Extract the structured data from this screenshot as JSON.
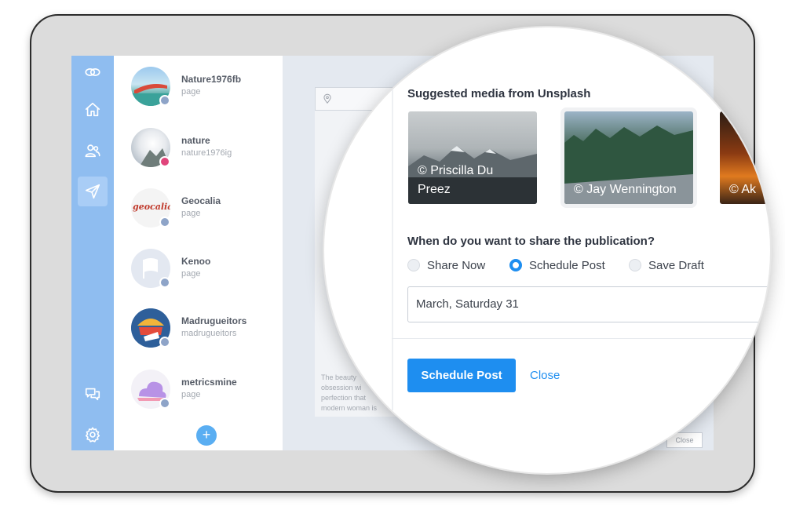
{
  "accounts": [
    {
      "name": "Nature1976fb",
      "type": "page"
    },
    {
      "name": "nature",
      "type": "nature1976ig"
    },
    {
      "name": "Geocalia",
      "type": "page",
      "logo_text": "geocalia"
    },
    {
      "name": "Kenoo",
      "type": "page"
    },
    {
      "name": "Madrugueitors",
      "type": "madrugueitors"
    },
    {
      "name": "metricsmine",
      "type": "page"
    }
  ],
  "add_label": "+",
  "editor": {
    "blurb": "The beauty obsession wi perfection that modern woman is",
    "close_label": "Close"
  },
  "dialog": {
    "suggested_heading": "Suggested media from Unsplash",
    "media": [
      {
        "caption": "© Priscilla Du Preez"
      },
      {
        "caption": "© Jay Wennington"
      },
      {
        "caption": "© Ak"
      }
    ],
    "share_heading": "When do you want to share the publication?",
    "options": [
      {
        "label": "Share Now",
        "selected": false
      },
      {
        "label": "Schedule Post",
        "selected": true
      },
      {
        "label": "Save Draft",
        "selected": false
      }
    ],
    "date_value": "March, Saturday 31",
    "primary_label": "Schedule Post",
    "close_label": "Close"
  },
  "colors": {
    "rail": "#8fbdf0",
    "accent": "#1e8ef0"
  },
  "icons": [
    "logo-icon",
    "home-icon",
    "users-icon",
    "send-icon",
    "chat-icon",
    "gear-icon",
    "location-pin-icon"
  ]
}
